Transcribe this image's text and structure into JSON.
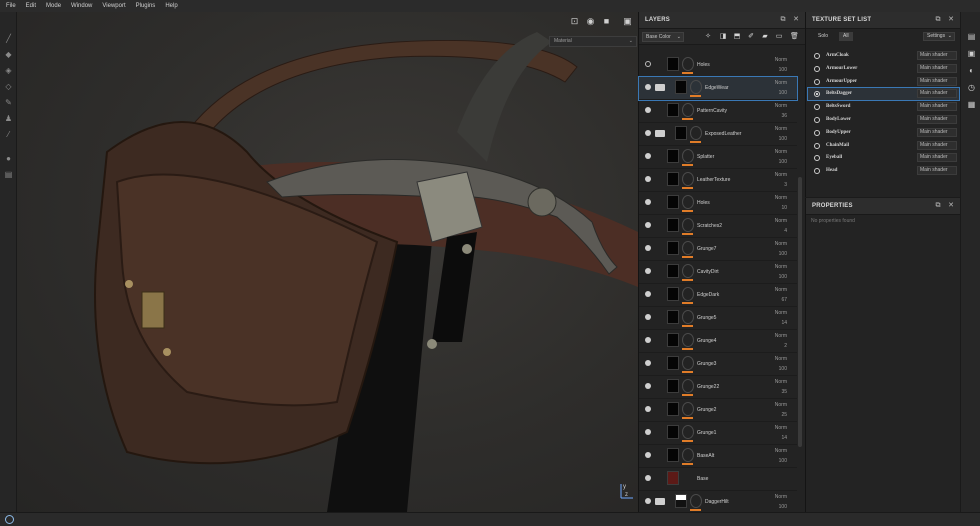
{
  "menu": [
    "File",
    "Edit",
    "Mode",
    "Window",
    "Viewport",
    "Plugins",
    "Help"
  ],
  "toolbar_icons": [
    "paint-brush-icon",
    "eraser-icon",
    "projection-icon",
    "geometry-mask-icon",
    "smudge-icon",
    "clone-stamp-icon",
    "color-picker-icon",
    "bake-icon",
    "export-icon"
  ],
  "viewport": {
    "icons": [
      "frame-icon",
      "render-icon",
      "camera-icon",
      "screenshot-icon"
    ],
    "channel": "Material"
  },
  "layers_panel": {
    "title": "LAYERS",
    "channel": "Base Color",
    "toolbar_icons": [
      "add-effect-icon",
      "add-mask-icon",
      "add-fill-icon",
      "add-paint-icon",
      "add-folder-icon",
      "add-layer-icon",
      "delete-icon"
    ],
    "layers": [
      {
        "name": "Holes",
        "blend": "Norm",
        "opacity": "100",
        "visible": false,
        "folder": false,
        "thumb": "black",
        "selected": false
      },
      {
        "name": "EdgeWear",
        "blend": "Norm",
        "opacity": "100",
        "visible": true,
        "folder": true,
        "thumb": "black",
        "selected": true
      },
      {
        "name": "PatternCavity",
        "blend": "Norm",
        "opacity": "36",
        "visible": true,
        "folder": false,
        "thumb": "black",
        "selected": false
      },
      {
        "name": "ExposedLeather",
        "blend": "Norm",
        "opacity": "100",
        "visible": true,
        "folder": true,
        "thumb": "black",
        "selected": false
      },
      {
        "name": "Splatter",
        "blend": "Norm",
        "opacity": "100",
        "visible": true,
        "folder": false,
        "thumb": "black",
        "selected": false
      },
      {
        "name": "LeatherTexture",
        "blend": "Norm",
        "opacity": "3",
        "visible": true,
        "folder": false,
        "thumb": "black",
        "selected": false
      },
      {
        "name": "Holes",
        "blend": "Norm",
        "opacity": "10",
        "visible": true,
        "folder": false,
        "thumb": "black",
        "selected": false
      },
      {
        "name": "Scratches2",
        "blend": "Norm",
        "opacity": "4",
        "visible": true,
        "folder": false,
        "thumb": "black",
        "selected": false
      },
      {
        "name": "Grunge7",
        "blend": "Norm",
        "opacity": "100",
        "visible": true,
        "folder": false,
        "thumb": "black",
        "selected": false
      },
      {
        "name": "CavityDirt",
        "blend": "Norm",
        "opacity": "100",
        "visible": true,
        "folder": false,
        "thumb": "black",
        "selected": false
      },
      {
        "name": "EdgeDark",
        "blend": "Norm",
        "opacity": "67",
        "visible": true,
        "folder": false,
        "thumb": "black",
        "selected": false
      },
      {
        "name": "Grunge5",
        "blend": "Norm",
        "opacity": "14",
        "visible": true,
        "folder": false,
        "thumb": "black",
        "selected": false
      },
      {
        "name": "Grunge4",
        "blend": "Norm",
        "opacity": "2",
        "visible": true,
        "folder": false,
        "thumb": "black",
        "selected": false
      },
      {
        "name": "Grunge3",
        "blend": "Norm",
        "opacity": "100",
        "visible": true,
        "folder": false,
        "thumb": "black",
        "selected": false
      },
      {
        "name": "Grunge22",
        "blend": "Norm",
        "opacity": "35",
        "visible": true,
        "folder": false,
        "thumb": "black",
        "selected": false
      },
      {
        "name": "Grunge2",
        "blend": "Norm",
        "opacity": "25",
        "visible": true,
        "folder": false,
        "thumb": "black",
        "selected": false
      },
      {
        "name": "Grunge1",
        "blend": "Norm",
        "opacity": "14",
        "visible": true,
        "folder": false,
        "thumb": "black",
        "selected": false
      },
      {
        "name": "BaseAlt",
        "blend": "Norm",
        "opacity": "100",
        "visible": true,
        "folder": false,
        "thumb": "black",
        "selected": false
      },
      {
        "name": "Base",
        "blend": "",
        "opacity": "",
        "visible": true,
        "folder": false,
        "thumb": "red",
        "selected": false
      },
      {
        "name": "DaggerHilt",
        "blend": "Norm",
        "opacity": "100",
        "visible": true,
        "folder": true,
        "thumb": "white",
        "selected": false
      }
    ]
  },
  "texture_set_list": {
    "title": "TEXTURE SET LIST",
    "tabs": [
      "Solo",
      "All"
    ],
    "settings_label": "Settings",
    "items": [
      {
        "name": "ArmCloak",
        "shader": "Main shader",
        "selected": false
      },
      {
        "name": "ArmourLower",
        "shader": "Main shader",
        "selected": false
      },
      {
        "name": "ArmourUpper",
        "shader": "Main shader",
        "selected": false
      },
      {
        "name": "BeltsDagger",
        "shader": "Main shader",
        "selected": true
      },
      {
        "name": "BeltsSword",
        "shader": "Main shader",
        "selected": false
      },
      {
        "name": "BodyLower",
        "shader": "Main shader",
        "selected": false
      },
      {
        "name": "BodyUpper",
        "shader": "Main shader",
        "selected": false
      },
      {
        "name": "ChainMail",
        "shader": "Main shader",
        "selected": false
      },
      {
        "name": "Eyeball",
        "shader": "Main shader",
        "selected": false
      },
      {
        "name": "Head",
        "shader": "Main shader",
        "selected": false
      }
    ]
  },
  "properties": {
    "title": "PROPERTIES",
    "empty_text": "No properties found"
  },
  "right_icons": [
    "texture-set-icon",
    "display-settings-icon",
    "shader-icon",
    "history-icon",
    "log-icon"
  ],
  "axis_labels": [
    "y",
    "z"
  ],
  "colors": {
    "accent": "#3a78b5",
    "orange": "#e07c28"
  }
}
